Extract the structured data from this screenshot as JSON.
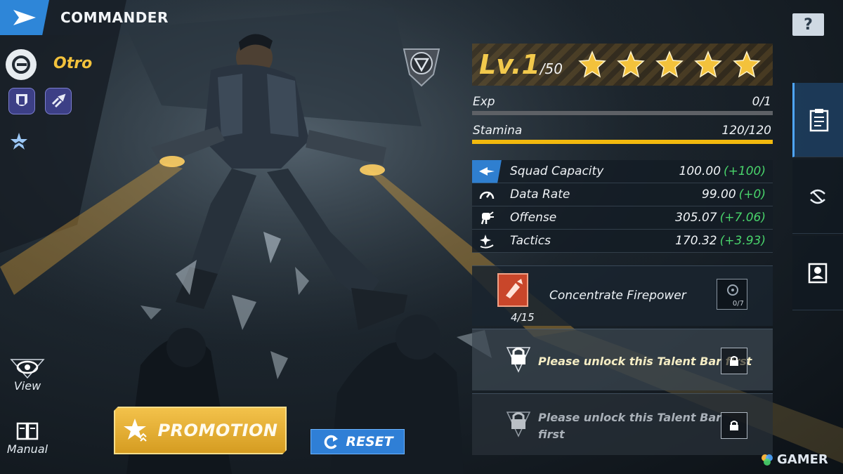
{
  "header": {
    "title": "COMMANDER"
  },
  "help": {
    "label": "?"
  },
  "commander": {
    "name": "Otro"
  },
  "left_actions": [
    {
      "label": "View",
      "icon": "eye-icon"
    },
    {
      "label": "Manual",
      "icon": "book-icon"
    }
  ],
  "level": {
    "current": "Lv.1",
    "max": "/50",
    "stars": 5
  },
  "exp": {
    "label": "Exp",
    "value": "0/1",
    "fraction": 0
  },
  "stamina": {
    "label": "Stamina",
    "value": "120/120",
    "fraction": 1.0
  },
  "stats": [
    {
      "icon": "jet-icon",
      "label": "Squad Capacity",
      "value": "100.00",
      "bonus": "(+100)"
    },
    {
      "icon": "gauge-icon",
      "label": "Data Rate",
      "value": "99.00",
      "bonus": "(+0)"
    },
    {
      "icon": "fist-icon",
      "label": "Offense",
      "value": "305.07",
      "bonus": "(+7.06)"
    },
    {
      "icon": "sparkle-icon",
      "label": "Tactics",
      "value": "170.32",
      "bonus": "(+3.93)"
    }
  ],
  "talents": {
    "active": {
      "name": "Concentrate Firepower",
      "count": "4/15",
      "slot_count": "0/7"
    },
    "locked_1": {
      "text": "Please unlock this Talent Bar first"
    },
    "locked_2": {
      "text_line1": "Please unlock this Talent Bar",
      "text_line2": "first"
    }
  },
  "buttons": {
    "promotion": "PROMOTION",
    "reset": "RESET"
  },
  "watermark": "GAMER",
  "colors": {
    "gold": "#f2c94c",
    "accent_blue": "#2f7fd0",
    "bonus_green": "#49d36b",
    "stamina_fill": "#f2b90e"
  }
}
